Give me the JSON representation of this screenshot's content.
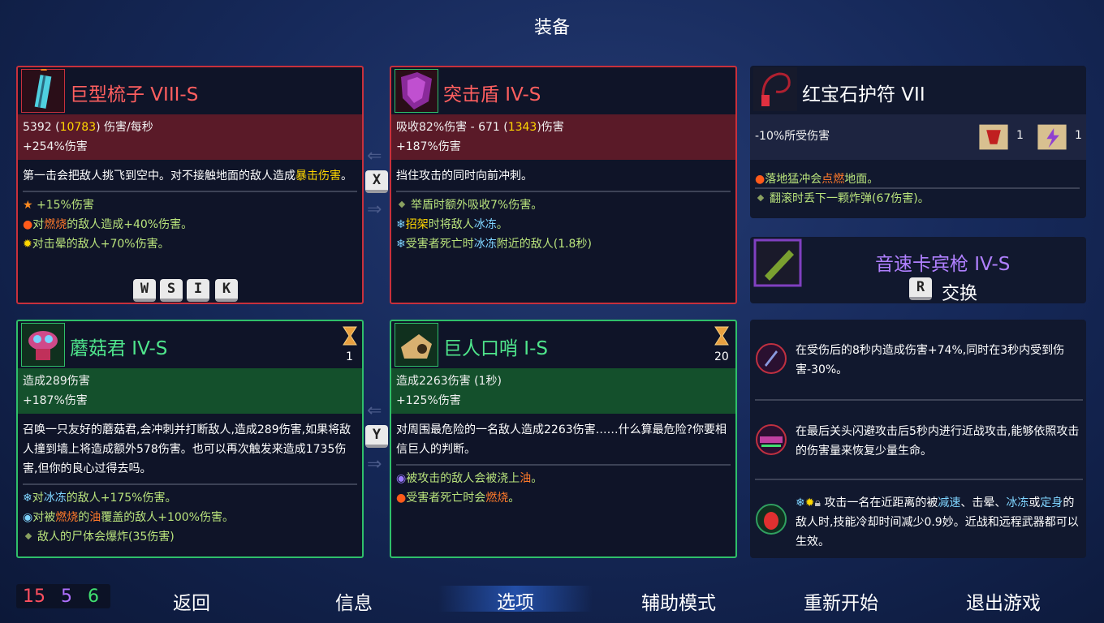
{
  "title": "装备",
  "weapon1": {
    "name": "巨型梳子 VIII-S",
    "stat1": "5392",
    "stat1_hl": "10783",
    "stat1_suffix": "伤害/每秒",
    "stat2": "+254%伤害",
    "desc_a": "第一击会把敌人挑飞到空中。对不接触地面的敌人造成",
    "desc_b": "暴击伤害",
    "desc_c": "。",
    "mod1": "+15%伤害",
    "mod2_a": "对",
    "mod2_b": "燃烧",
    "mod2_c": "的敌人造成+40%伤害。",
    "mod3": "对击晕的敌人+70%伤害。",
    "keys": [
      "W",
      "S",
      "I",
      "K"
    ]
  },
  "weapon2": {
    "name": "突击盾 IV-S",
    "stat1": "吸收82%伤害 - 671 (",
    "stat1_hl": "1343",
    "stat1_suffix": ")伤害",
    "stat2": "+187%伤害",
    "desc": "挡住攻击的同时向前冲刺。",
    "mod1": "举盾时额外吸收7%伤害。",
    "mod2_a": "招架",
    "mod2_b": "时将敌人",
    "mod2_c": "冰冻",
    "mod2_d": "。",
    "mod3_a": "受害者死亡时",
    "mod3_b": "冰冻",
    "mod3_c": "附近的敌人(1.8秒)"
  },
  "swap_key_top": "X",
  "swap_key_bottom": "Y",
  "skill1": {
    "name": "蘑菇君 IV-S",
    "cooldown": "1",
    "stat1": "造成289伤害",
    "stat2": "+187%伤害",
    "desc": "召唤一只友好的蘑菇君,会冲刺并打断敌人,造成289伤害,如果将敌人撞到墙上将造成额外578伤害。也可以再次触发来造成1735伤害,但你的良心过得去吗。",
    "mod1_a": "对",
    "mod1_b": "冰冻",
    "mod1_c": "的敌人+175%伤害。",
    "mod2_a": "对被",
    "mod2_b": "燃烧",
    "mod2_c": "的",
    "mod2_d": "油",
    "mod2_e": "覆盖的敌人+100%伤害。",
    "mod3": "敌人的尸体会爆炸(35伤害)"
  },
  "skill2": {
    "name": "巨人口哨 I-S",
    "cooldown": "20",
    "stat1": "造成2263伤害 (1秒)",
    "stat2": "+125%伤害",
    "desc": "对周围最危险的一名敌人造成2263伤害……什么算最危险?你要相信巨人的判断。",
    "mod1_a": "被攻击的敌人会被浇上",
    "mod1_b": "油",
    "mod1_c": "。",
    "mod2_a": "受害者死亡时会",
    "mod2_b": "燃烧",
    "mod2_c": "。"
  },
  "amulet": {
    "name": "红宝石护符 VII",
    "stat": "-10%所受伤害",
    "scroll1_count": "1",
    "scroll2_count": "1",
    "mod1_a": "落地猛冲会",
    "mod1_b": "点燃",
    "mod1_c": "地面。",
    "mod2": "翻滚时丢下一颗炸弹(67伤害)。"
  },
  "backpack": {
    "name": "音速卡宾枪 IV-S",
    "key": "R",
    "swap_label": "交换"
  },
  "mutations": [
    {
      "text": "在受伤后的8秒内造成伤害+74%,同时在3秒内受到伤害-30%。"
    },
    {
      "text": "在最后关头闪避攻击后5秒内进行近战攻击,能够依照攻击的伤害量来恢复少量生命。"
    },
    {
      "a": "攻击一名在近距离的被",
      "b": "减速",
      "c": "、击晕、",
      "d": "冰冻",
      "e": "或",
      "f": "定身",
      "g": "的敌人时,技能冷却时间减少0.9妙。近战和远程武器都可以生效。"
    }
  ],
  "scores": {
    "red": "15",
    "purple": "5",
    "green": "6"
  },
  "nav": {
    "back": "返回",
    "info": "信息",
    "options": "选项",
    "assist": "辅助模式",
    "restart": "重新开始",
    "quit": "退出游戏"
  },
  "colors": {
    "red_border": "#c8303c",
    "green_border": "#2fbf6a",
    "highlight": "#ffd700",
    "ice": "#7fd4ff",
    "fire": "#ff7a2a"
  }
}
